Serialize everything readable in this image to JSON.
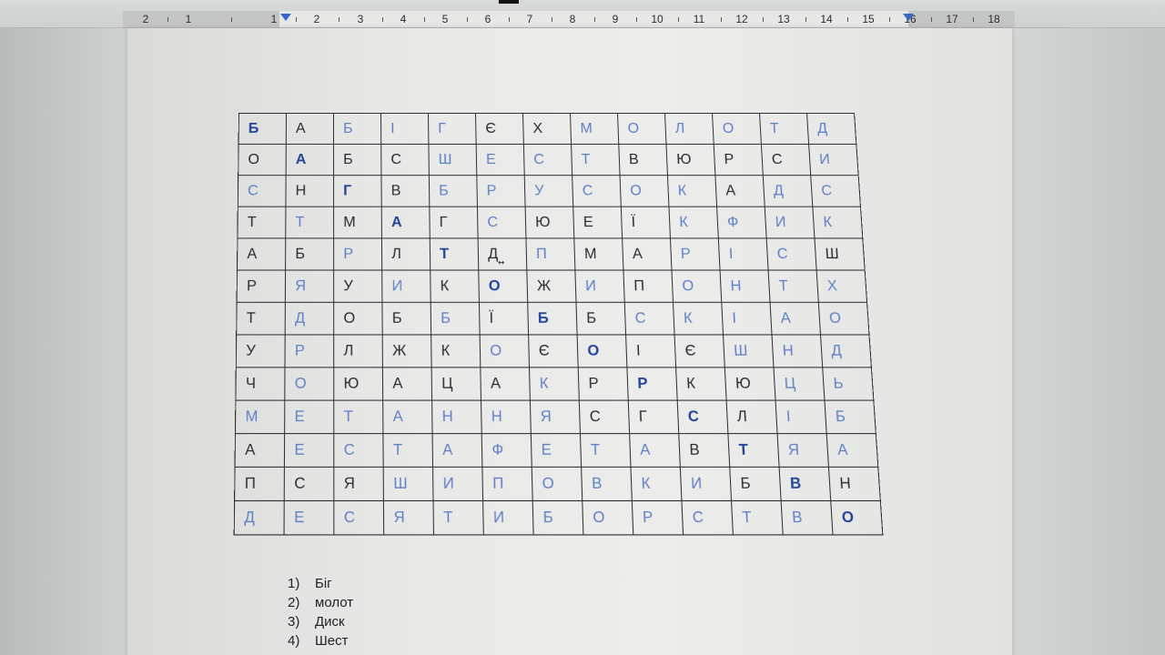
{
  "ruler": {
    "labels": [
      "2",
      "1",
      "1",
      "2",
      "3",
      "4",
      "5",
      "6",
      "7",
      "8",
      "9",
      "10",
      "11",
      "12",
      "13",
      "14",
      "15",
      "16",
      "17",
      "18"
    ]
  },
  "grid": {
    "rows": [
      [
        [
          "Б",
          "bold"
        ],
        [
          "А",
          "dark"
        ],
        [
          "Б",
          "blue"
        ],
        [
          "І",
          "blue"
        ],
        [
          "Г",
          "blue"
        ],
        [
          "Є",
          "dark"
        ],
        [
          "Х",
          "dark"
        ],
        [
          "М",
          "blue"
        ],
        [
          "О",
          "blue"
        ],
        [
          "Л",
          "blue"
        ],
        [
          "О",
          "blue"
        ],
        [
          "Т",
          "blue"
        ],
        [
          "Д",
          "blue"
        ]
      ],
      [
        [
          "О",
          "dark"
        ],
        [
          "А",
          "bold"
        ],
        [
          "Б",
          "dark"
        ],
        [
          "С",
          "dark"
        ],
        [
          "Ш",
          "blue"
        ],
        [
          "Е",
          "blue"
        ],
        [
          "С",
          "blue"
        ],
        [
          "Т",
          "blue"
        ],
        [
          "В",
          "dark"
        ],
        [
          "Ю",
          "dark"
        ],
        [
          "Р",
          "dark"
        ],
        [
          "С",
          "dark"
        ],
        [
          "И",
          "blue"
        ]
      ],
      [
        [
          "С",
          "blue"
        ],
        [
          "Н",
          "dark"
        ],
        [
          "Г",
          "bold"
        ],
        [
          "В",
          "dark"
        ],
        [
          "Б",
          "blue"
        ],
        [
          "Р",
          "blue"
        ],
        [
          "У",
          "blue"
        ],
        [
          "С",
          "blue"
        ],
        [
          "О",
          "blue"
        ],
        [
          "К",
          "blue"
        ],
        [
          "А",
          "dark"
        ],
        [
          "Д",
          "blue"
        ],
        [
          "С",
          "blue"
        ]
      ],
      [
        [
          "Т",
          "dark"
        ],
        [
          "Т",
          "blue"
        ],
        [
          "М",
          "dark"
        ],
        [
          "А",
          "bold"
        ],
        [
          "Г",
          "dark"
        ],
        [
          "С",
          "blue"
        ],
        [
          "Ю",
          "dark"
        ],
        [
          "Е",
          "dark"
        ],
        [
          "Ї",
          "dark"
        ],
        [
          "К",
          "blue"
        ],
        [
          "Ф",
          "blue"
        ],
        [
          "И",
          "blue"
        ],
        [
          "К",
          "blue"
        ]
      ],
      [
        [
          "А",
          "dark"
        ],
        [
          "Б",
          "dark"
        ],
        [
          "Р",
          "blue"
        ],
        [
          "Л",
          "dark"
        ],
        [
          "Т",
          "bold"
        ],
        [
          "Д",
          "dark"
        ],
        [
          "П",
          "blue"
        ],
        [
          "М",
          "dark"
        ],
        [
          "А",
          "dark"
        ],
        [
          "Р",
          "blue"
        ],
        [
          "І",
          "blue"
        ],
        [
          "С",
          "blue"
        ],
        [
          "Ш",
          "dark"
        ]
      ],
      [
        [
          "Р",
          "dark"
        ],
        [
          "Я",
          "blue"
        ],
        [
          "У",
          "dark"
        ],
        [
          "И",
          "blue"
        ],
        [
          "К",
          "dark"
        ],
        [
          "О",
          "bold"
        ],
        [
          "Ж",
          "dark"
        ],
        [
          "И",
          "blue"
        ],
        [
          "П",
          "dark"
        ],
        [
          "О",
          "blue"
        ],
        [
          "Н",
          "blue"
        ],
        [
          "Т",
          "blue"
        ],
        [
          "Х",
          "blue"
        ]
      ],
      [
        [
          "Т",
          "dark"
        ],
        [
          "Д",
          "blue"
        ],
        [
          "О",
          "dark"
        ],
        [
          "Б",
          "dark"
        ],
        [
          "Б",
          "blue"
        ],
        [
          "Ї",
          "dark"
        ],
        [
          "Б",
          "bold"
        ],
        [
          "Б",
          "dark"
        ],
        [
          "С",
          "blue"
        ],
        [
          "К",
          "blue"
        ],
        [
          "І",
          "blue"
        ],
        [
          "А",
          "blue"
        ],
        [
          "О",
          "blue"
        ]
      ],
      [
        [
          "У",
          "dark"
        ],
        [
          "Р",
          "blue"
        ],
        [
          "Л",
          "dark"
        ],
        [
          "Ж",
          "dark"
        ],
        [
          "К",
          "dark"
        ],
        [
          "О",
          "blue"
        ],
        [
          "Є",
          "dark"
        ],
        [
          "О",
          "bold"
        ],
        [
          "І",
          "dark"
        ],
        [
          "Є",
          "dark"
        ],
        [
          "Ш",
          "blue"
        ],
        [
          "Н",
          "blue"
        ],
        [
          "Д",
          "blue"
        ]
      ],
      [
        [
          "Ч",
          "dark"
        ],
        [
          "О",
          "blue"
        ],
        [
          "Ю",
          "dark"
        ],
        [
          "А",
          "dark"
        ],
        [
          "Ц",
          "dark"
        ],
        [
          "А",
          "dark"
        ],
        [
          "К",
          "blue"
        ],
        [
          "Р",
          "dark"
        ],
        [
          "Р",
          "bold"
        ],
        [
          "К",
          "dark"
        ],
        [
          "Ю",
          "dark"
        ],
        [
          "Ц",
          "blue"
        ],
        [
          "Ь",
          "blue"
        ]
      ],
      [
        [
          "М",
          "blue"
        ],
        [
          "Е",
          "blue"
        ],
        [
          "Т",
          "blue"
        ],
        [
          "А",
          "blue"
        ],
        [
          "Н",
          "blue"
        ],
        [
          "Н",
          "blue"
        ],
        [
          "Я",
          "blue"
        ],
        [
          "С",
          "dark"
        ],
        [
          "Г",
          "dark"
        ],
        [
          "С",
          "bold"
        ],
        [
          "Л",
          "dark"
        ],
        [
          "І",
          "blue"
        ],
        [
          "Б",
          "blue"
        ]
      ],
      [
        [
          "А",
          "dark"
        ],
        [
          "Е",
          "blue"
        ],
        [
          "С",
          "blue"
        ],
        [
          "Т",
          "blue"
        ],
        [
          "А",
          "blue"
        ],
        [
          "Ф",
          "blue"
        ],
        [
          "Е",
          "blue"
        ],
        [
          "Т",
          "blue"
        ],
        [
          "А",
          "blue"
        ],
        [
          "В",
          "dark"
        ],
        [
          "Т",
          "bold"
        ],
        [
          "Я",
          "blue"
        ],
        [
          "А",
          "blue"
        ]
      ],
      [
        [
          "П",
          "dark"
        ],
        [
          "С",
          "dark"
        ],
        [
          "Я",
          "dark"
        ],
        [
          "Ш",
          "blue"
        ],
        [
          "И",
          "blue"
        ],
        [
          "П",
          "blue"
        ],
        [
          "О",
          "blue"
        ],
        [
          "В",
          "blue"
        ],
        [
          "К",
          "blue"
        ],
        [
          "И",
          "blue"
        ],
        [
          "Б",
          "dark"
        ],
        [
          "В",
          "bold"
        ],
        [
          "Н",
          "dark"
        ]
      ],
      [
        [
          "Д",
          "blue"
        ],
        [
          "Е",
          "blue"
        ],
        [
          "С",
          "blue"
        ],
        [
          "Я",
          "blue"
        ],
        [
          "Т",
          "blue"
        ],
        [
          "И",
          "blue"
        ],
        [
          "Б",
          "blue"
        ],
        [
          "О",
          "blue"
        ],
        [
          "Р",
          "blue"
        ],
        [
          "С",
          "blue"
        ],
        [
          "Т",
          "blue"
        ],
        [
          "В",
          "blue"
        ],
        [
          "О",
          "bold"
        ]
      ]
    ]
  },
  "word_list": [
    {
      "num": "1)",
      "text": "Біг"
    },
    {
      "num": "2)",
      "text": "молот"
    },
    {
      "num": "3)",
      "text": "Диск"
    },
    {
      "num": "4)",
      "text": "Шест"
    }
  ],
  "colors": {
    "dark": "#2a2a2a",
    "blue": "#5e7fc7",
    "bold": "#24439a"
  }
}
